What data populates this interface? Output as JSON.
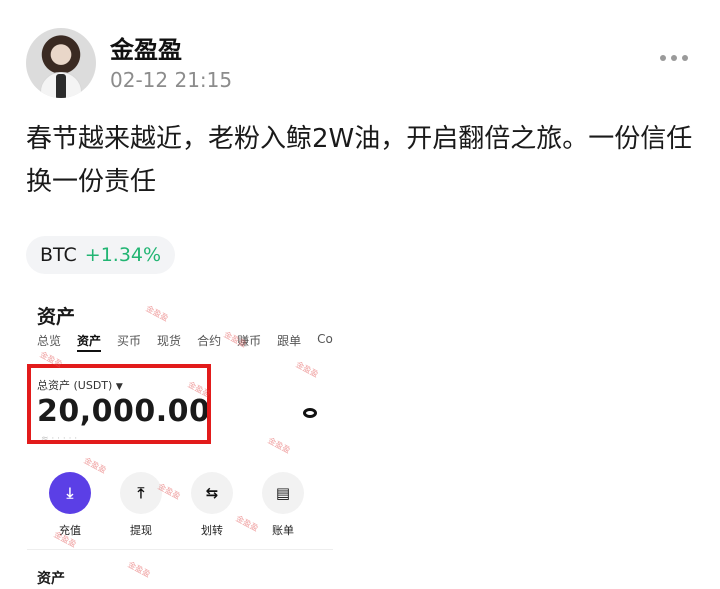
{
  "post": {
    "author": "金盈盈",
    "time": "02-12 21:15",
    "text": "春节越来越近，老粉入鲸2W油，开启翻倍之旅。一份信任换一份责任"
  },
  "ticker": {
    "symbol": "BTC",
    "change": "+1.34%",
    "change_color": "#22b573"
  },
  "screenshot": {
    "title": "资产",
    "tabs": [
      "总览",
      "资产",
      "买币",
      "现货",
      "合约",
      "赚币",
      "跟单",
      "Co"
    ],
    "active_tab": "资产",
    "total_label": "总资产 (USDT)",
    "total_value": "20,000.00",
    "actions": [
      {
        "label": "充值",
        "icon": "deposit-icon"
      },
      {
        "label": "提现",
        "icon": "withdraw-icon"
      },
      {
        "label": "划转",
        "icon": "transfer-icon"
      },
      {
        "label": "账单",
        "icon": "bill-icon"
      }
    ],
    "section_title": "资产",
    "watermark": "金盈盈",
    "highlight_color": "#e21b1b",
    "primary_color": "#5b3fe6"
  }
}
